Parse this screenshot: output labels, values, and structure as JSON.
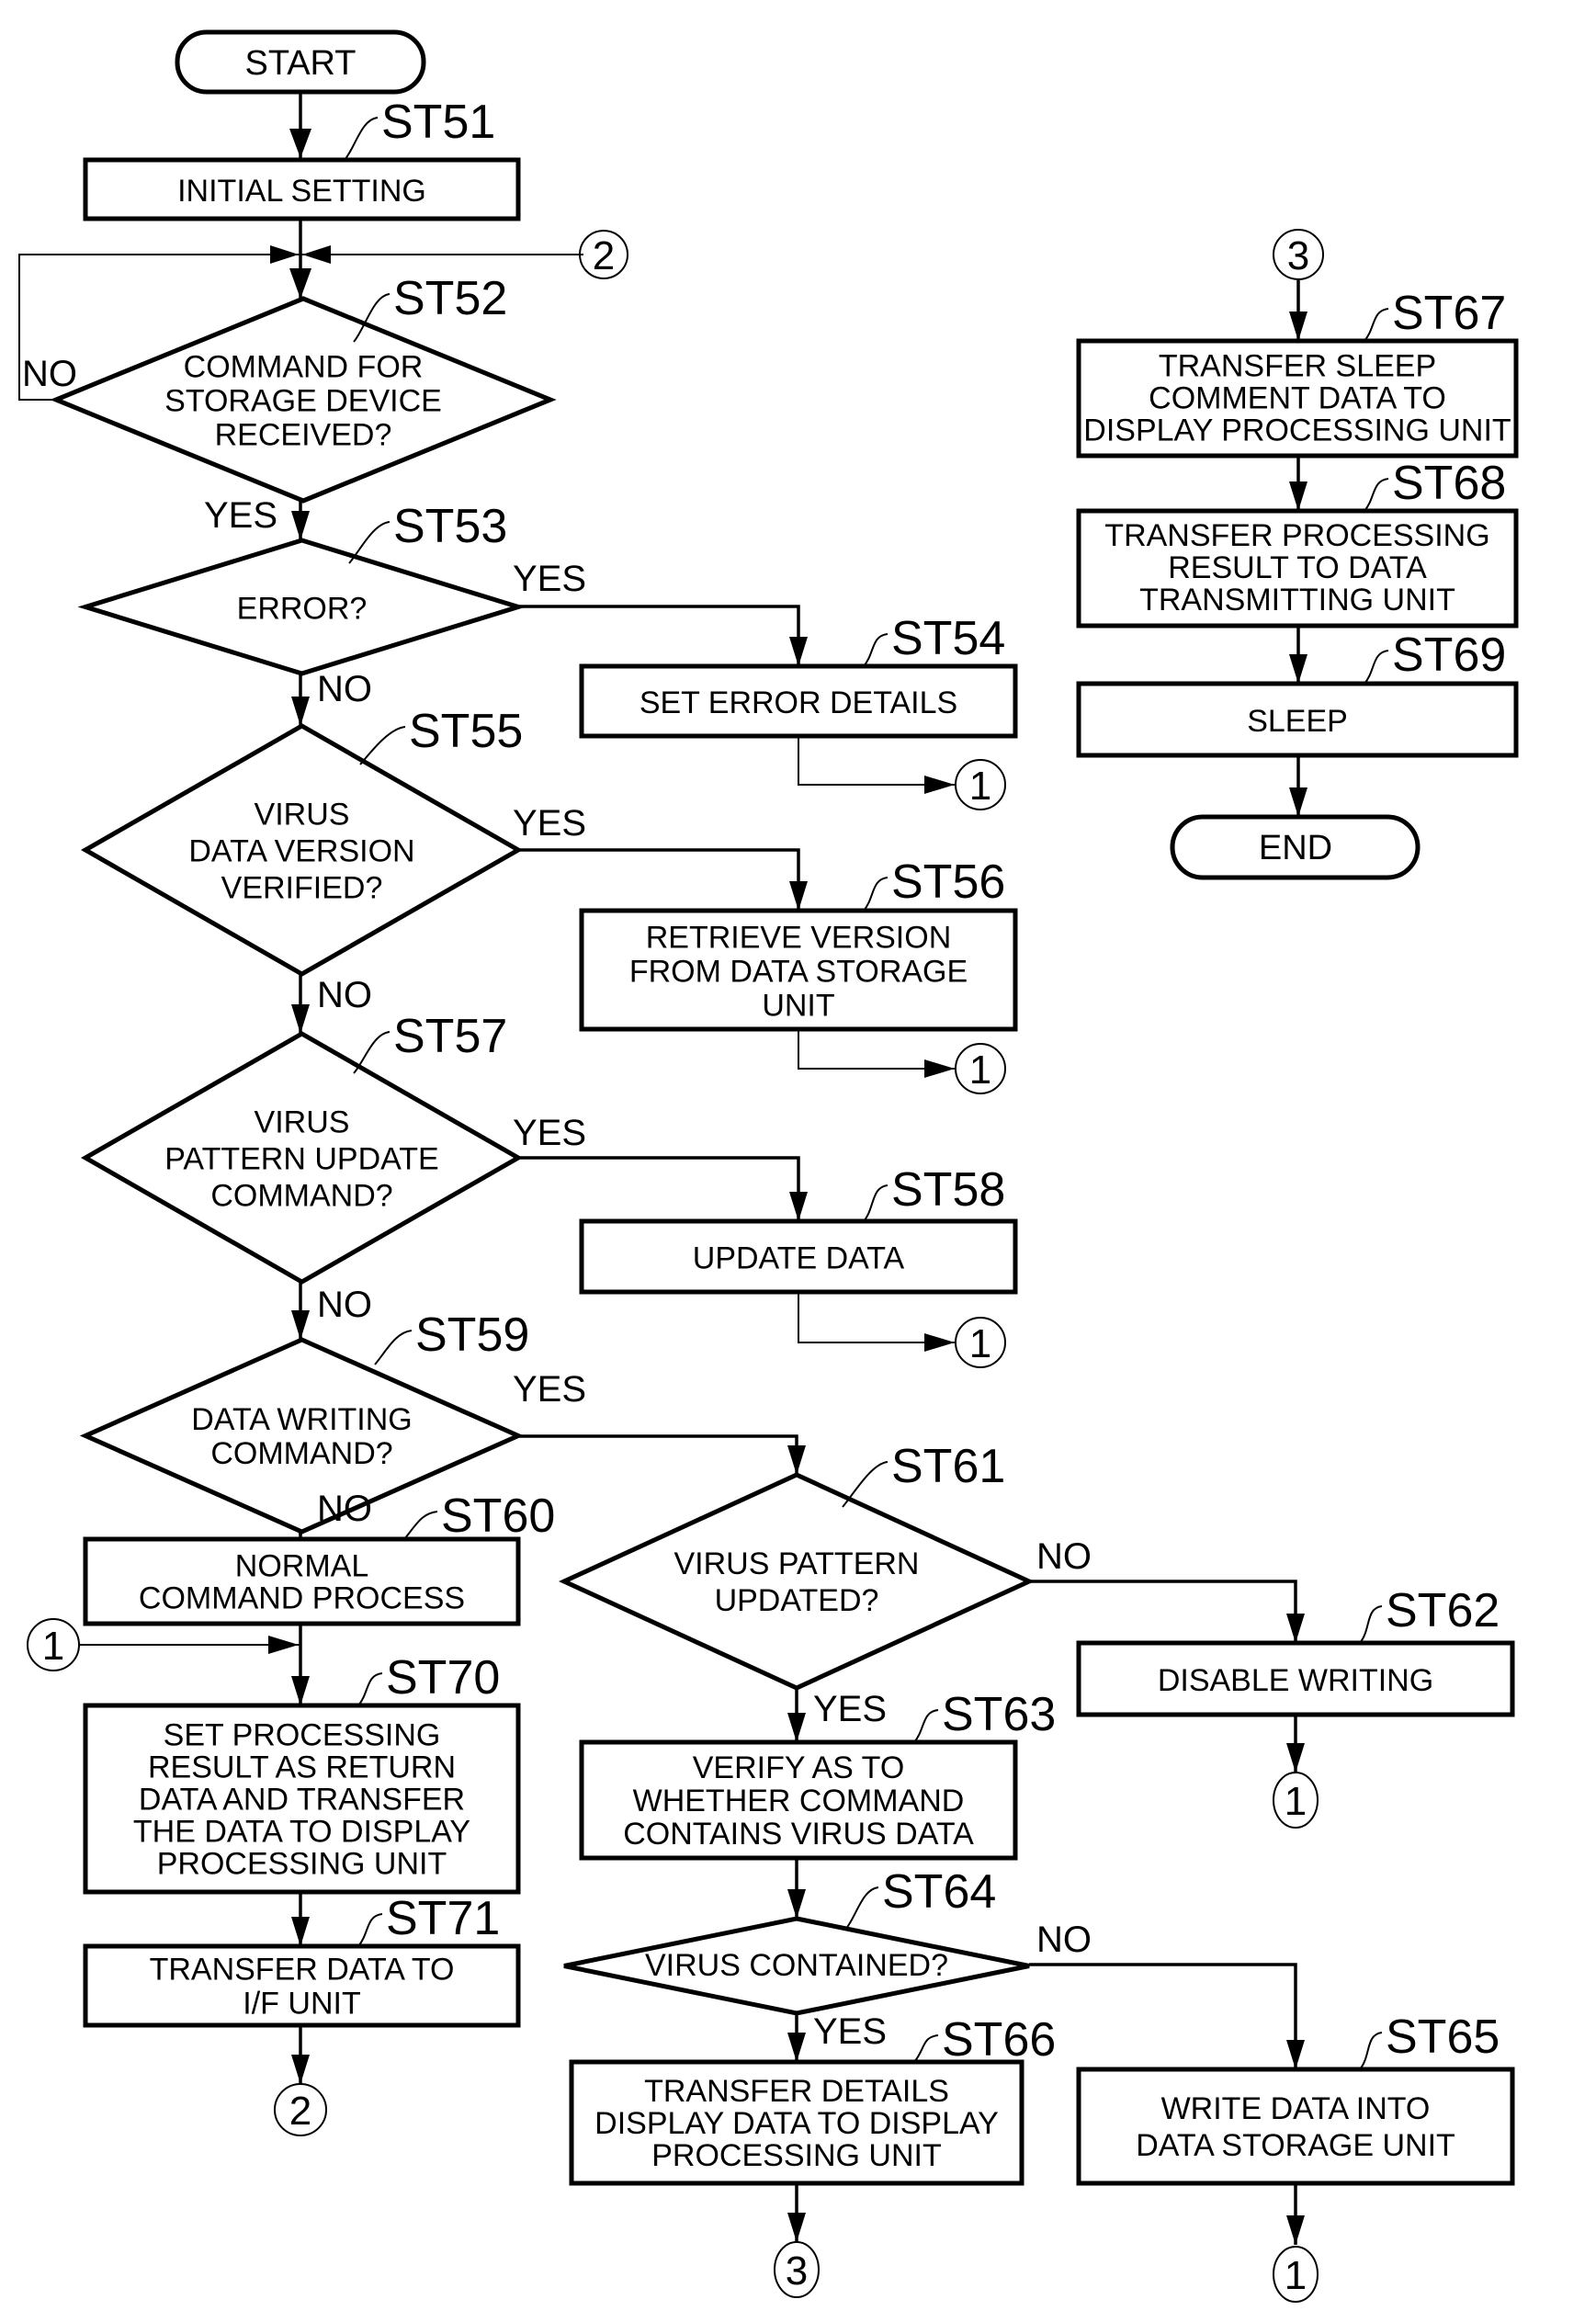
{
  "figure": {
    "terminals": {
      "start": "START",
      "end": "END"
    },
    "steps": {
      "ST51": {
        "id": "ST51",
        "type": "process",
        "lines": [
          "INITIAL SETTING"
        ]
      },
      "ST52": {
        "id": "ST52",
        "type": "decision",
        "lines": [
          "COMMAND FOR",
          "STORAGE DEVICE",
          "RECEIVED?"
        ],
        "yes": "YES",
        "no": "NO"
      },
      "ST53": {
        "id": "ST53",
        "type": "decision",
        "lines": [
          "ERROR?"
        ],
        "yes": "YES",
        "no": "NO"
      },
      "ST54": {
        "id": "ST54",
        "type": "process",
        "lines": [
          "SET ERROR DETAILS"
        ]
      },
      "ST55": {
        "id": "ST55",
        "type": "decision",
        "lines": [
          "VIRUS",
          "DATA VERSION",
          "VERIFIED?"
        ],
        "yes": "YES",
        "no": "NO"
      },
      "ST56": {
        "id": "ST56",
        "type": "process",
        "lines": [
          "RETRIEVE VERSION",
          "FROM DATA STORAGE",
          "UNIT"
        ]
      },
      "ST57": {
        "id": "ST57",
        "type": "decision",
        "lines": [
          "VIRUS",
          "PATTERN UPDATE",
          "COMMAND?"
        ],
        "yes": "YES",
        "no": "NO"
      },
      "ST58": {
        "id": "ST58",
        "type": "process",
        "lines": [
          "UPDATE DATA"
        ]
      },
      "ST59": {
        "id": "ST59",
        "type": "decision",
        "lines": [
          "DATA WRITING",
          "COMMAND?"
        ],
        "yes": "YES",
        "no": "NO"
      },
      "ST60": {
        "id": "ST60",
        "type": "process",
        "lines": [
          "NORMAL",
          "COMMAND PROCESS"
        ]
      },
      "ST61": {
        "id": "ST61",
        "type": "decision",
        "lines": [
          "VIRUS PATTERN",
          "UPDATED?"
        ],
        "yes": "YES",
        "no": "NO"
      },
      "ST62": {
        "id": "ST62",
        "type": "process",
        "lines": [
          "DISABLE WRITING"
        ]
      },
      "ST63": {
        "id": "ST63",
        "type": "process",
        "lines": [
          "VERIFY AS TO",
          "WHETHER COMMAND",
          "CONTAINS VIRUS DATA"
        ]
      },
      "ST64": {
        "id": "ST64",
        "type": "decision",
        "lines": [
          "VIRUS CONTAINED?"
        ],
        "yes": "YES",
        "no": "NO"
      },
      "ST65": {
        "id": "ST65",
        "type": "process",
        "lines": [
          "WRITE DATA INTO",
          "DATA STORAGE UNIT"
        ]
      },
      "ST66": {
        "id": "ST66",
        "type": "process",
        "lines": [
          "TRANSFER DETAILS",
          "DISPLAY DATA TO DISPLAY",
          "PROCESSING UNIT"
        ]
      },
      "ST67": {
        "id": "ST67",
        "type": "process",
        "lines": [
          "TRANSFER SLEEP",
          "COMMENT DATA TO",
          "DISPLAY PROCESSING UNIT"
        ]
      },
      "ST68": {
        "id": "ST68",
        "type": "process",
        "lines": [
          "TRANSFER PROCESSING",
          "RESULT TO DATA",
          "TRANSMITTING UNIT"
        ]
      },
      "ST69": {
        "id": "ST69",
        "type": "process",
        "lines": [
          "SLEEP"
        ]
      },
      "ST70": {
        "id": "ST70",
        "type": "process",
        "lines": [
          "SET PROCESSING",
          "RESULT AS RETURN",
          "DATA AND TRANSFER",
          "THE DATA TO DISPLAY",
          "PROCESSING UNIT"
        ]
      },
      "ST71": {
        "id": "ST71",
        "type": "process",
        "lines": [
          "TRANSFER DATA TO",
          "I/F UNIT"
        ]
      }
    },
    "connectors": {
      "c1": "1",
      "c2": "2",
      "c3": "3"
    }
  }
}
